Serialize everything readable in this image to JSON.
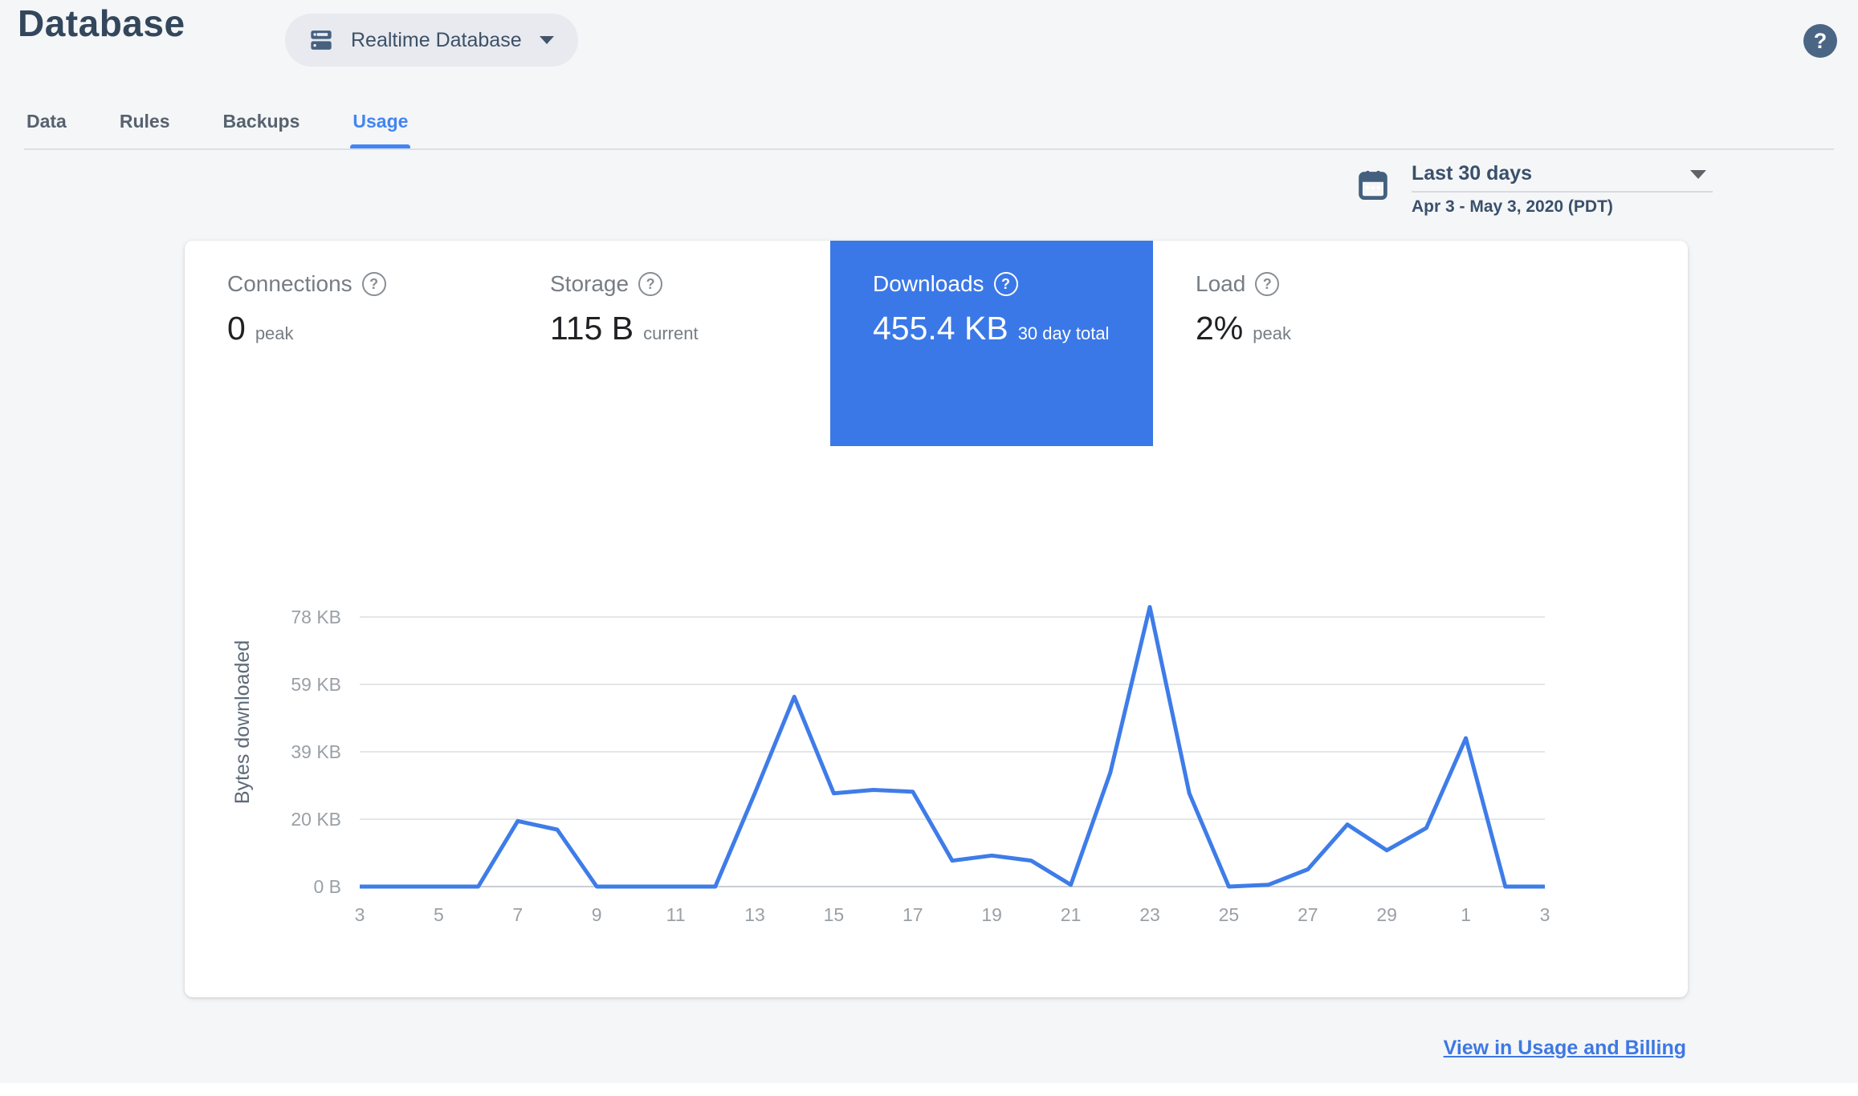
{
  "header": {
    "title": "Database",
    "selector_label": "Realtime Database"
  },
  "help": {
    "glyph": "?"
  },
  "tabs": [
    {
      "label": "Data",
      "active": false
    },
    {
      "label": "Rules",
      "active": false
    },
    {
      "label": "Backups",
      "active": false
    },
    {
      "label": "Usage",
      "active": true
    }
  ],
  "date_picker": {
    "range_label": "Last 30 days",
    "range_detail": "Apr 3 - May 3, 2020 (PDT)"
  },
  "metrics": [
    {
      "label": "Connections",
      "value": "0",
      "unit": "peak",
      "selected": false
    },
    {
      "label": "Storage",
      "value": "115 B",
      "unit": "current",
      "selected": false
    },
    {
      "label": "Downloads",
      "value": "455.4 KB",
      "unit": "30 day total",
      "selected": true
    },
    {
      "label": "Load",
      "value": "2%",
      "unit": "peak",
      "selected": false
    }
  ],
  "chart_data": {
    "type": "line",
    "title": "Downloads (bytes downloaded per day)",
    "xlabel": "",
    "ylabel": "Bytes downloaded",
    "series_name": "Bytes downloaded",
    "x_range_days": [
      "Apr 3, 2020",
      "May 3, 2020"
    ],
    "days": [
      3,
      4,
      5,
      6,
      7,
      8,
      9,
      10,
      11,
      12,
      13,
      14,
      15,
      16,
      17,
      18,
      19,
      20,
      21,
      22,
      23,
      24,
      25,
      26,
      27,
      28,
      29,
      30,
      1,
      2,
      3
    ],
    "values_kb": [
      0,
      0,
      0,
      0,
      19,
      16.5,
      0,
      0,
      0,
      0,
      27,
      55,
      27,
      28,
      27.5,
      7.5,
      9,
      7.5,
      0.5,
      33,
      81,
      27,
      0,
      0.5,
      5,
      18,
      10.5,
      17,
      43,
      0,
      0
    ],
    "y_ticks": [
      {
        "kb": 0,
        "label": "0 B"
      },
      {
        "kb": 19.5,
        "label": "20 KB"
      },
      {
        "kb": 39.1,
        "label": "39 KB"
      },
      {
        "kb": 58.6,
        "label": "59 KB"
      },
      {
        "kb": 78.1,
        "label": "78 KB"
      }
    ],
    "x_tick_labels": [
      {
        "i": 0,
        "label": "3"
      },
      {
        "i": 2,
        "label": "5"
      },
      {
        "i": 4,
        "label": "7"
      },
      {
        "i": 6,
        "label": "9"
      },
      {
        "i": 8,
        "label": "11"
      },
      {
        "i": 10,
        "label": "13"
      },
      {
        "i": 12,
        "label": "15"
      },
      {
        "i": 14,
        "label": "17"
      },
      {
        "i": 16,
        "label": "19"
      },
      {
        "i": 18,
        "label": "21"
      },
      {
        "i": 20,
        "label": "23"
      },
      {
        "i": 22,
        "label": "25"
      },
      {
        "i": 24,
        "label": "27"
      },
      {
        "i": 26,
        "label": "29"
      },
      {
        "i": 28,
        "label": "1"
      },
      {
        "i": 30,
        "label": "3"
      }
    ],
    "ylim_kb": [
      0,
      85
    ],
    "grid": "on",
    "legend": "none",
    "line_color": "#3e7ce8"
  },
  "footer": {
    "link_label": "View in Usage and Billing"
  },
  "colors": {
    "accent_blue": "#3b78e7",
    "tab_active_blue": "#4285f4",
    "link_blue": "#3d78e3",
    "header_text": "#33475c",
    "slate_icon": "#44607f",
    "page_bg": "#f5f6f8",
    "gridline": "#e4e6e9",
    "axis_line": "#c9ced3",
    "tick_text": "#9aa0a6"
  },
  "icons": {
    "selector": "database-icon",
    "selector_caret": "chevron-down-icon",
    "help": "help-icon",
    "calendar": "calendar-icon",
    "date_caret": "chevron-down-icon",
    "metric_help": "help-circle-icon"
  }
}
